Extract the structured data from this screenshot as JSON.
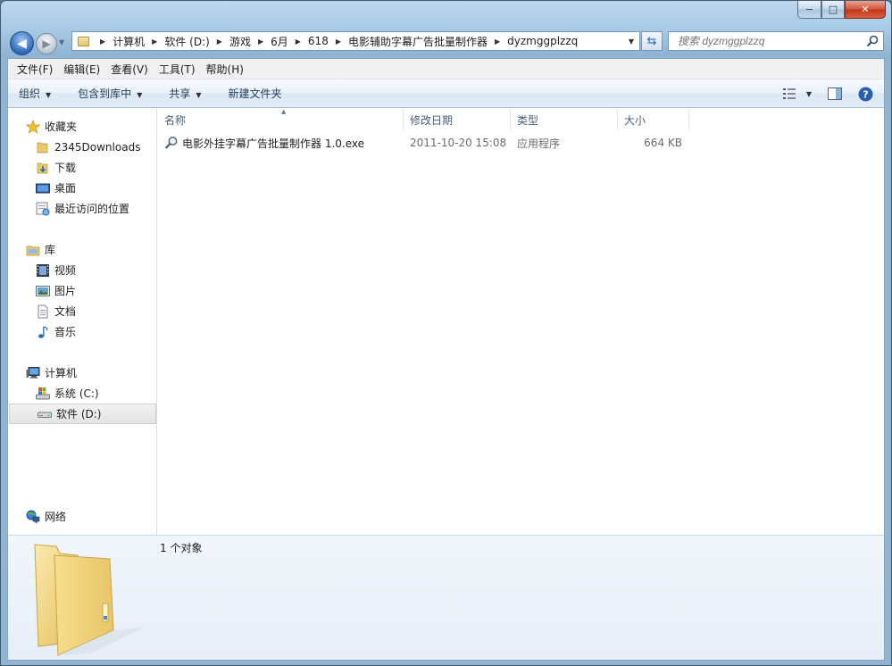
{
  "window": {
    "caption_buttons": {
      "minimize": "−",
      "maximize": "□",
      "close": "✕"
    }
  },
  "nav": {
    "back_glyph": "◀",
    "forward_glyph": "▶",
    "breadcrumbs": [
      "计算机",
      "软件 (D:)",
      "游戏",
      "6月",
      "618",
      "电影辅助字幕广告批量制作器",
      "dyzmggplzzq"
    ],
    "search_placeholder": "搜索 dyzmggplzzq"
  },
  "menubar": {
    "file": "文件(F)",
    "edit": "编辑(E)",
    "view": "查看(V)",
    "tools": "工具(T)",
    "help": "帮助(H)"
  },
  "toolbar": {
    "organize": "组织",
    "include_in_library": "包含到库中",
    "share": "共享",
    "new_folder": "新建文件夹"
  },
  "sidebar": {
    "favorites": {
      "label": "收藏夹",
      "items": [
        "2345Downloads",
        "下载",
        "桌面",
        "最近访问的位置"
      ]
    },
    "libraries": {
      "label": "库",
      "items": [
        "视频",
        "图片",
        "文档",
        "音乐"
      ]
    },
    "computer": {
      "label": "计算机",
      "items": [
        "系统 (C:)",
        "软件 (D:)"
      ],
      "selected": "软件 (D:)"
    },
    "network": {
      "label": "网络"
    }
  },
  "columns": {
    "name": "名称",
    "modified": "修改日期",
    "type": "类型",
    "size": "大小"
  },
  "files": [
    {
      "name": "电影外挂字幕广告批量制作器 1.0.exe",
      "modified": "2011-10-20 15:08",
      "type": "应用程序",
      "size": "664 KB"
    }
  ],
  "details": {
    "count": "1 个对象"
  },
  "colors": {
    "accent": "#2b66b8",
    "folder": "#e8c96c"
  }
}
